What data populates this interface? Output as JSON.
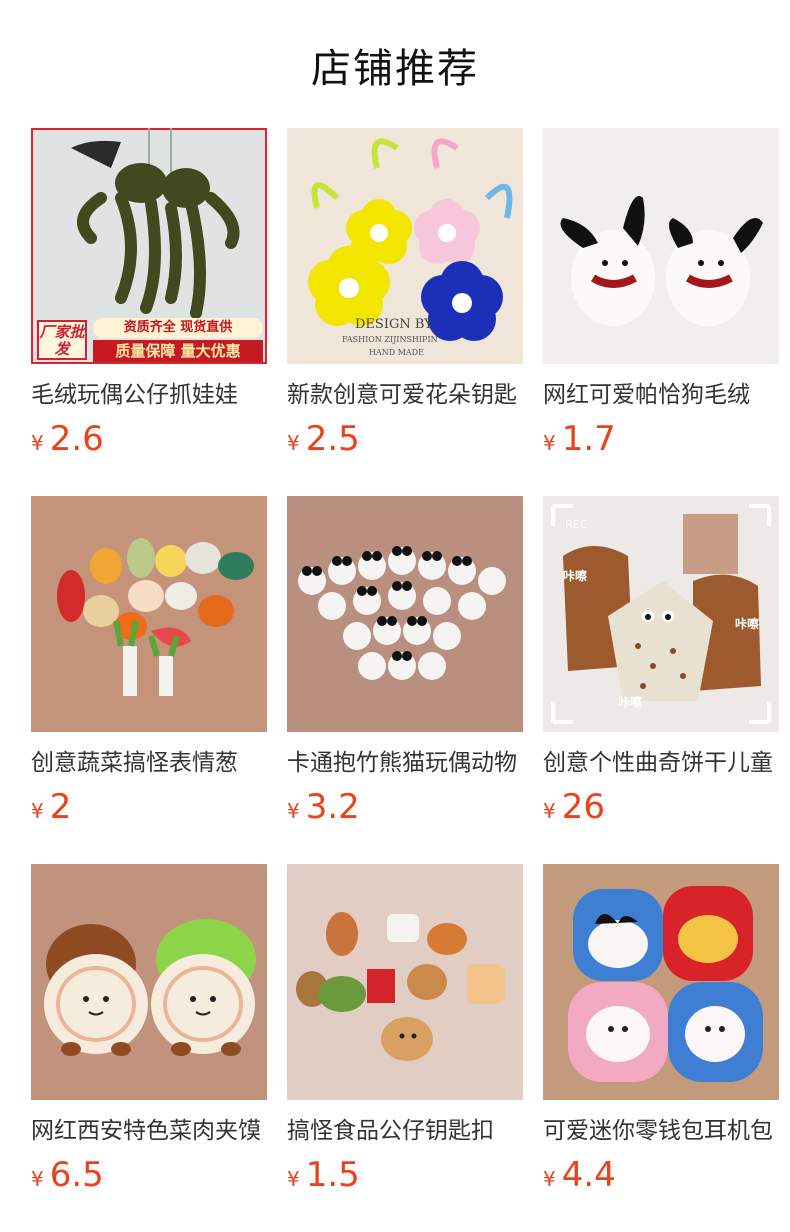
{
  "header": {
    "title": "店铺推荐"
  },
  "currency_symbol": "¥",
  "badge": {
    "wholesale": "厂家批发",
    "line1": "资质齐全 现货直供",
    "line2": "质量保障 量大优惠"
  },
  "products": [
    {
      "name": "毛绒玩偶公仔抓娃娃",
      "price": "2.6",
      "image": "plush-frog-keychains"
    },
    {
      "name": "新款创意可爱花朵钥匙",
      "price": "2.5",
      "image": "flower-keychains",
      "image_text": [
        "DESIGN BY",
        "FASHION ZIJINSHIPIN",
        "HAND MADE"
      ]
    },
    {
      "name": "网红可爱帕恰狗毛绒",
      "price": "1.7",
      "image": "white-dog-plush"
    },
    {
      "name": "创意蔬菜搞怪表情葱",
      "price": "2",
      "image": "vegetable-plush"
    },
    {
      "name": "卡通抱竹熊猫玩偶动物",
      "price": "3.2",
      "image": "panda-plush"
    },
    {
      "name": "创意个性曲奇饼干儿童",
      "price": "26",
      "image": "cookie-backpacks",
      "image_text": [
        "REC",
        "咔嚓",
        "咔嚓",
        "咔嚓"
      ]
    },
    {
      "name": "网红西安特色菜肉夹馍",
      "price": "6.5",
      "image": "roujiamo-plush"
    },
    {
      "name": "搞怪食品公仔钥匙扣",
      "price": "1.5",
      "image": "food-plush-keychains"
    },
    {
      "name": "可爱迷你零钱包耳机包",
      "price": "4.4",
      "image": "mini-coin-purses"
    }
  ]
}
